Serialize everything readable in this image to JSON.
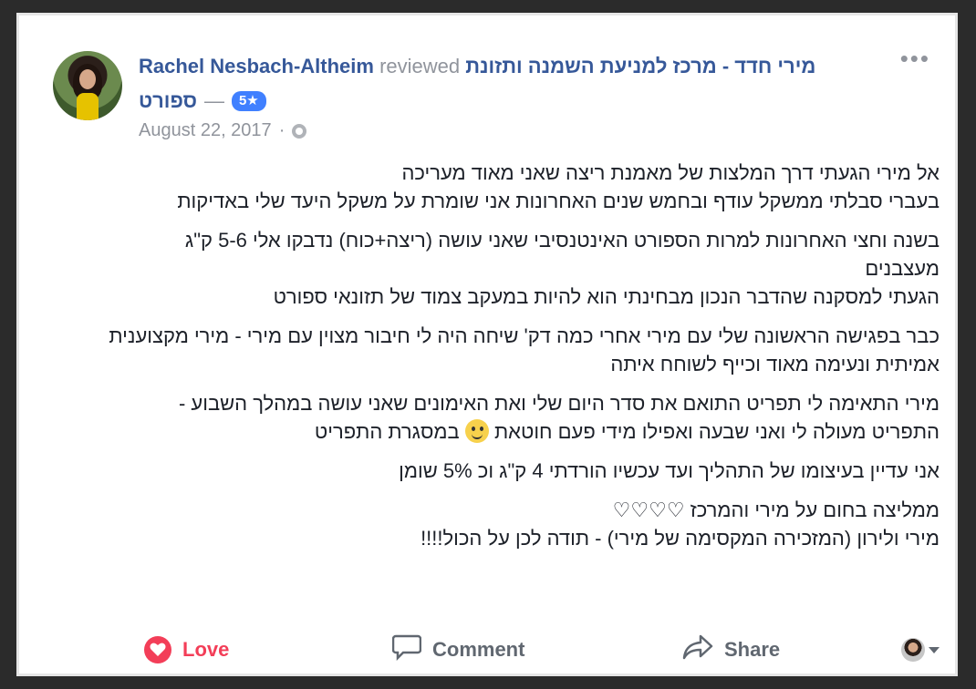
{
  "post": {
    "author": "Rachel Nesbach-Altheim",
    "verb": "reviewed",
    "page_name_line1": "מירי חדד - מרכז למניעת השמנה ותזונת",
    "page_name_line2": "ספורט",
    "rating": "5★",
    "date": "August 22, 2017",
    "privacy_icon": "globe-icon",
    "more_label": "•••"
  },
  "review": {
    "paragraphs": [
      {
        "lines": [
          "אל מירי הגעתי דרך המלצות של מאמנת ריצה שאני מאוד מעריכה",
          "בעברי סבלתי ממשקל עודף ובחמש שנים האחרונות אני שומרת על משקל היעד שלי באדיקות"
        ]
      },
      {
        "lines": [
          "בשנה וחצי האחרונות למרות הספורט האינטנסיבי שאני עושה (ריצה+כוח) נדבקו אלי 5-6 ק\"ג מעצבנים",
          "הגעתי למסקנה שהדבר הנכון מבחינתי הוא להיות במעקב צמוד של תזונאי ספורט"
        ]
      },
      {
        "lines": [
          "כבר בפגישה הראשונה שלי עם מירי אחרי כמה דק' שיחה היה לי חיבור מצוין עם מירי - מירי מקצוענית אמיתית ונעימה מאוד וכייף לשוחח איתה"
        ]
      },
      {
        "lines": [
          "מירי התאימה לי תפריט התואם את סדר היום שלי ואת האימונים שאני עושה במהלך השבוע - התפריט מעולה לי ואני שבעה ואפילו מידי פעם חוטאת",
          "במסגרת התפריט"
        ]
      },
      {
        "lines": [
          "אני עדיין בעיצומו של התהליך ועד עכשיו הורדתי 4 ק\"ג וכ 5% שומן"
        ]
      },
      {
        "lines": [
          "ממליצה בחום על מירי והמרכז ♡♡♡♡",
          "מירי ולירון (המזכירה המקסימה של מירי) - תודה לכן על הכול!!!!"
        ]
      }
    ]
  },
  "actions": {
    "love": "Love",
    "comment": "Comment",
    "share": "Share"
  },
  "colors": {
    "link": "#365899",
    "meta": "#90949c",
    "love": "#f33e58",
    "badge": "#4080ff"
  }
}
